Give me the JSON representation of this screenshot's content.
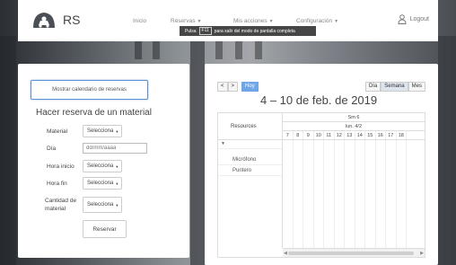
{
  "brand": {
    "name": "RS"
  },
  "nav": {
    "items": [
      {
        "label": "Inicio",
        "has_caret": false
      },
      {
        "label": "Reservas",
        "has_caret": true
      },
      {
        "label": "Mis acciones",
        "has_caret": true
      },
      {
        "label": "Configuración",
        "has_caret": true
      }
    ],
    "logout_label": "Logout"
  },
  "fullscreen_toast": {
    "prefix": "Pulsa",
    "key": "F11",
    "suffix": "para salir del modo de pantalla completa"
  },
  "reservation_form": {
    "show_calendar_button": "Mostrar calendario de reservas",
    "title": "Hacer reserva de un material",
    "fields": {
      "material": {
        "label": "Material",
        "value": "Selecciona"
      },
      "day": {
        "label": "Día",
        "placeholder": "dd/mm/aaaa"
      },
      "start_time": {
        "label": "Hora inicio",
        "value": "Selecciona"
      },
      "end_time": {
        "label": "Hora fin",
        "value": "Selecciona"
      },
      "quantity": {
        "label_line1": "Cantidad de",
        "label_line2": "material",
        "value": "Selecciona"
      }
    },
    "submit_label": "Reservar"
  },
  "calendar": {
    "prev_label": "<",
    "next_label": ">",
    "today_label": "Hoy",
    "title": "4 – 10 de feb. de 2019",
    "views": [
      {
        "label": "Día",
        "active": false
      },
      {
        "label": "Semana",
        "active": true
      },
      {
        "label": "Mes",
        "active": false
      }
    ],
    "resources_header": "Resources",
    "week_label": "Sm 6",
    "day_label": "lun. 4/2",
    "hours": [
      "7",
      "8",
      "9",
      "10",
      "11",
      "12",
      "13",
      "14",
      "15",
      "16",
      "17",
      "18"
    ],
    "group_toggle": "▼",
    "resources": [
      "Micrófono",
      "Puntero"
    ]
  },
  "colors": {
    "accent": "#6fa6e8",
    "active_view": "#dde4ee",
    "highlight_border": "#5b8fd6"
  }
}
